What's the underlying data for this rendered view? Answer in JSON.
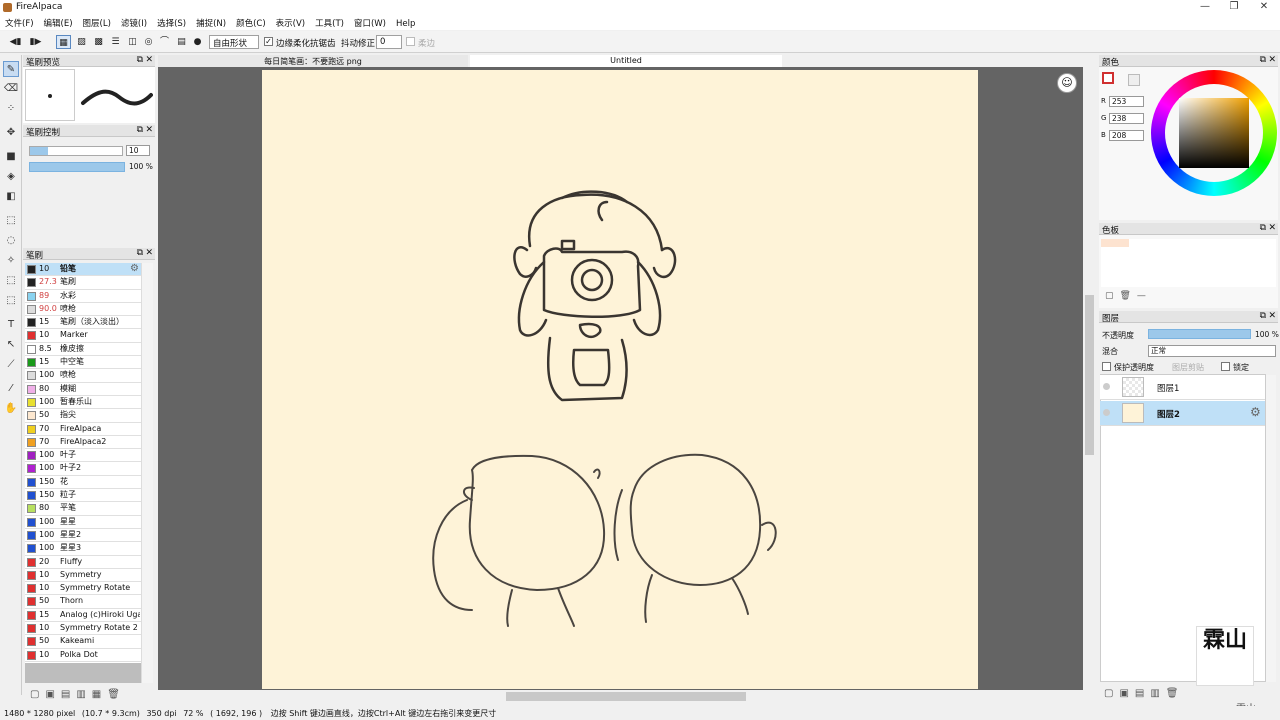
{
  "window": {
    "title": "FireAlpaca",
    "minimize": "—",
    "maximize": "❐",
    "close": "✕"
  },
  "menu": [
    "文件(F)",
    "编辑(E)",
    "图层(L)",
    "滤镜(I)",
    "选择(S)",
    "捕捉(N)",
    "颜色(C)",
    "表示(V)",
    "工具(T)",
    "窗口(W)",
    "Help"
  ],
  "toolbar": {
    "shape_select": "自由形状",
    "antialias_label": "边缘柔化抗锯齿",
    "antialias_checked": true,
    "stabilizer_label": "抖动修正",
    "stabilizer_value": "0",
    "soft_label": "柔边"
  },
  "tabs": [
    {
      "label": "每日简笔画：不要跑远 png",
      "active": false
    },
    {
      "label": "Untitled",
      "active": true
    }
  ],
  "brush_preview": {
    "title": "笔刷预览"
  },
  "brush_control": {
    "title": "笔刷控制",
    "size": "10",
    "opacity": "100 %"
  },
  "brush_panel": {
    "title": "笔刷",
    "items": [
      {
        "size": "10",
        "name": "铅笔",
        "color": "#222222",
        "size_color": "#111",
        "selected": true
      },
      {
        "size": "27.3",
        "name": "笔刷",
        "color": "#222222",
        "size_color": "#d04040"
      },
      {
        "size": "89",
        "name": "水彩",
        "color": "#8ad3f0",
        "size_color": "#d04040"
      },
      {
        "size": "90.0",
        "name": "喷枪",
        "color": "#dddddd",
        "size_color": "#d04040"
      },
      {
        "size": "15",
        "name": "笔刷（淡入淡出）",
        "color": "#222222",
        "size_color": "#111"
      },
      {
        "size": "10",
        "name": "Marker",
        "color": "#e03030",
        "size_color": "#111"
      },
      {
        "size": "8.5",
        "name": "橡皮擦",
        "color": "#ffffff",
        "size_color": "#111"
      },
      {
        "size": "15",
        "name": "中空笔",
        "color": "#1a9a1a",
        "size_color": "#111"
      },
      {
        "size": "100",
        "name": "喷枪",
        "color": "#dddddd",
        "size_color": "#111"
      },
      {
        "size": "80",
        "name": "模糊",
        "color": "#f0b0e8",
        "size_color": "#111"
      },
      {
        "size": "100",
        "name": "暂春乐山",
        "color": "#e8e030",
        "size_color": "#111"
      },
      {
        "size": "50",
        "name": "指尖",
        "color": "#fde8d0",
        "size_color": "#111"
      },
      {
        "size": "70",
        "name": "FireAlpaca",
        "color": "#f0d020",
        "size_color": "#111"
      },
      {
        "size": "70",
        "name": "FireAlpaca2",
        "color": "#f0a020",
        "size_color": "#111"
      },
      {
        "size": "100",
        "name": "叶子",
        "color": "#a020c0",
        "size_color": "#111"
      },
      {
        "size": "100",
        "name": "叶子2",
        "color": "#b020d0",
        "size_color": "#111"
      },
      {
        "size": "150",
        "name": "花",
        "color": "#2050d0",
        "size_color": "#111"
      },
      {
        "size": "150",
        "name": "粒子",
        "color": "#2050d0",
        "size_color": "#111"
      },
      {
        "size": "80",
        "name": "平笔",
        "color": "#b8e060",
        "size_color": "#111"
      },
      {
        "size": "100",
        "name": "星星",
        "color": "#2050d0",
        "size_color": "#111"
      },
      {
        "size": "100",
        "name": "星星2",
        "color": "#2050d0",
        "size_color": "#111"
      },
      {
        "size": "100",
        "name": "星星3",
        "color": "#2050d0",
        "size_color": "#111"
      },
      {
        "size": "20",
        "name": "Fluffy",
        "color": "#e03030",
        "size_color": "#111"
      },
      {
        "size": "10",
        "name": "Symmetry",
        "color": "#e03030",
        "size_color": "#111"
      },
      {
        "size": "10",
        "name": "Symmetry Rotate",
        "color": "#e03030",
        "size_color": "#111"
      },
      {
        "size": "50",
        "name": "Thorn",
        "color": "#e03030",
        "size_color": "#111"
      },
      {
        "size": "15",
        "name": "Analog (c)Hiroki Uga",
        "color": "#e03030",
        "size_color": "#111"
      },
      {
        "size": "10",
        "name": "Symmetry Rotate 2",
        "color": "#e03030",
        "size_color": "#111"
      },
      {
        "size": "50",
        "name": "Kakeami",
        "color": "#e03030",
        "size_color": "#111"
      },
      {
        "size": "10",
        "name": "Polka Dot",
        "color": "#e03030",
        "size_color": "#111"
      }
    ]
  },
  "color_panel": {
    "title": "颜色",
    "r": "253",
    "g": "238",
    "b": "208",
    "r_label": "R",
    "g_label": "G",
    "b_label": "B"
  },
  "swatch_panel": {
    "title": "色板"
  },
  "layer_panel": {
    "title": "图层",
    "opacity_label": "不透明度",
    "opacity_value": "100 %",
    "blend_label": "混合",
    "blend_value": "正常",
    "protect_label": "保护透明度",
    "clip_label": "图层剪贴",
    "lock_label": "锁定",
    "layers": [
      {
        "name": "图层1",
        "selected": false
      },
      {
        "name": "图层2",
        "selected": true
      }
    ]
  },
  "status": {
    "dims": "1480 * 1280 pixel",
    "cm": "(10.7 * 9.3cm)",
    "dpi": "350 dpi",
    "zoom": "72 %",
    "coords": "( 1692, 196 )",
    "hint": "边按 Shift 键边画直线，边按Ctrl+Alt 键边左右拖引来变更尺寸"
  },
  "watermark": {
    "text": "霖山",
    "corner_text": "霖山"
  },
  "colors": {
    "paper": "#fef3d8",
    "canvas_bg": "#646464",
    "accent": "#bfe0f7"
  }
}
